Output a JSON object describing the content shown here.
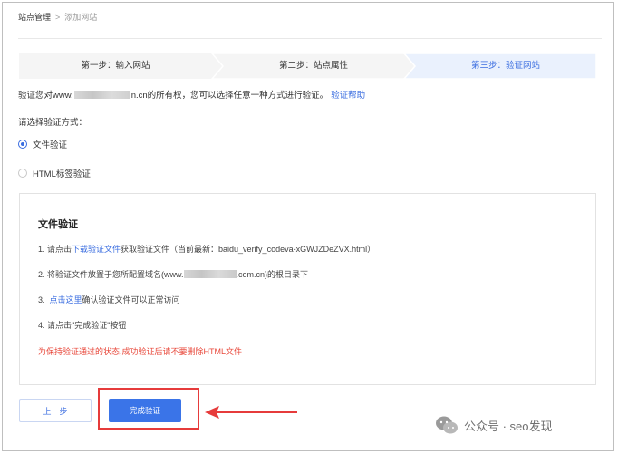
{
  "breadcrumb": {
    "root": "站点管理",
    "separator": ">",
    "current": "添加网站"
  },
  "steps": [
    {
      "label": "第一步：输入网站",
      "active": false
    },
    {
      "label": "第二步：站点属性",
      "active": false
    },
    {
      "label": "第三步：验证网站",
      "active": true
    }
  ],
  "intro": {
    "prefix": "验证您对www.",
    "suffix": "n.cn的所有权，您可以选择任意一种方式进行验证。",
    "help_link": "验证帮助"
  },
  "choose_label": "请选择验证方式：",
  "methods": [
    {
      "label": "文件验证",
      "selected": true
    },
    {
      "label": "HTML标签验证",
      "selected": false
    }
  ],
  "panel": {
    "title": "文件验证",
    "step1": {
      "prefix": "1.  请点击",
      "link": "下载验证文件",
      "suffix": "获取验证文件（当前最新：baidu_verify_codeva-xGWJZDeZVX.html）"
    },
    "step2": {
      "prefix": "2.  将验证文件放置于您所配置域名(www.",
      "suffix": ".com.cn)的根目录下"
    },
    "step3": {
      "prefix": "3.  ",
      "link": "点击这里",
      "suffix": "确认验证文件可以正常访问"
    },
    "step4": {
      "text": "4.  请点击\"完成验证\"按钮"
    },
    "warning": "为保持验证通过的状态,成功验证后请不要删除HTML文件"
  },
  "buttons": {
    "prev": "上一步",
    "finish": "完成验证"
  },
  "watermark": "公众号 · seo发现",
  "colors": {
    "accent": "#3a6de0",
    "warning": "#e8483b",
    "highlight": "#e63b3b",
    "step_active_bg": "#eaf1fd",
    "step_bg": "#f5f5f5"
  }
}
